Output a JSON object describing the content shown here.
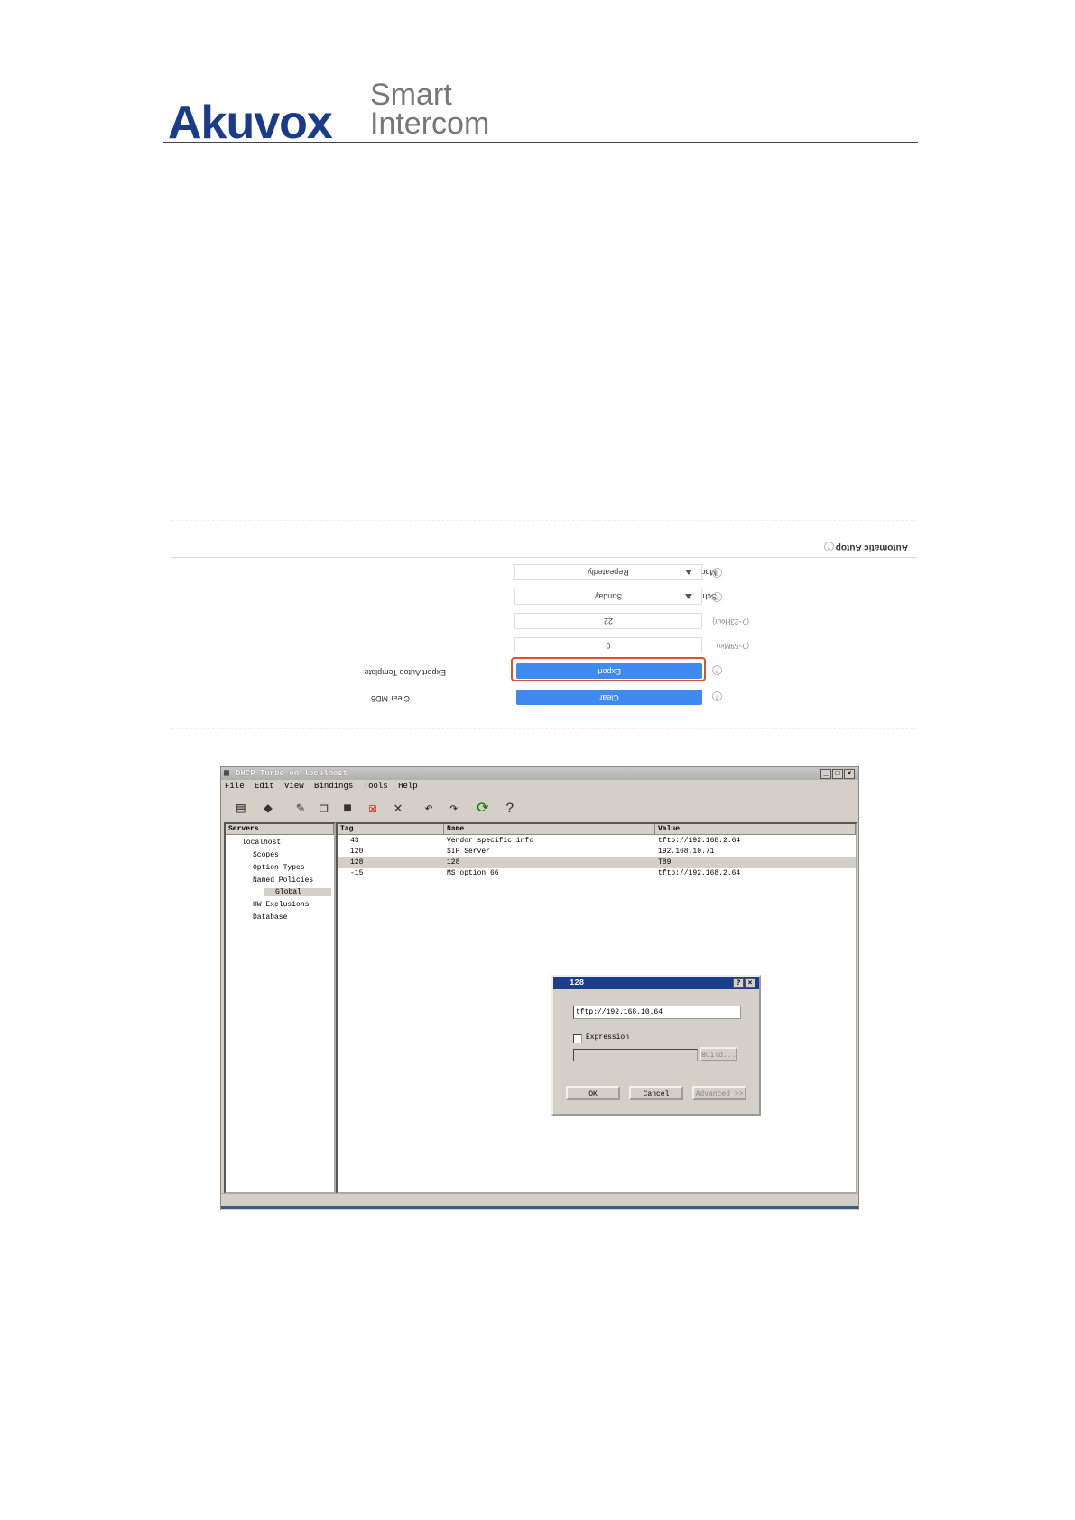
{
  "header": {
    "brand": "Akuvox",
    "tagline_line1": "Smart",
    "tagline_line2": "Intercom",
    "brand_color": "#1a3a8a"
  },
  "autop_panel": {
    "section_title": "Automatic Autop",
    "rows": [
      {
        "label": "Mode",
        "value": "Repeatedly",
        "control": "select"
      },
      {
        "label": "Schedule",
        "value": "Sunday",
        "control": "select"
      },
      {
        "label": "",
        "value": "22",
        "hint": "(0~23Hour)",
        "control": "input"
      },
      {
        "label": "",
        "value": "0",
        "hint": "(0~59Min)",
        "control": "input"
      },
      {
        "label": "Export Autop Template",
        "value": "Export",
        "control": "button"
      },
      {
        "label": "Clear MD5",
        "value": "Clear",
        "control": "button"
      }
    ],
    "highlight_color": "#d9542b",
    "button_color": "#3d8af0"
  },
  "dhcp_window": {
    "title": "DHCP Turbo on localhost",
    "menu": [
      "File",
      "Edit",
      "View",
      "Bindings",
      "Tools",
      "Help"
    ],
    "toolbar_icons": [
      "new-icon",
      "tag-icon",
      "pin-icon",
      "copy-icon",
      "paste-icon",
      "delete-icon",
      "tools-icon",
      "undo-icon",
      "redo-icon",
      "refresh-icon",
      "help-icon"
    ],
    "left_header": "Servers",
    "tree": [
      {
        "label": "localhost",
        "level": 0
      },
      {
        "label": "Scopes",
        "level": 1
      },
      {
        "label": "Option Types",
        "level": 1
      },
      {
        "label": "Named Policies",
        "level": 1
      },
      {
        "label": "Global",
        "level": 2,
        "selected": true
      },
      {
        "label": "HW Exclusions",
        "level": 1
      },
      {
        "label": "Database",
        "level": 1
      }
    ],
    "columns": [
      "Tag",
      "Name",
      "Value"
    ],
    "rows": [
      {
        "tag": "43",
        "name": "Vendor specific info",
        "value": "tftp://192.168.2.64"
      },
      {
        "tag": "120",
        "name": "SIP Server",
        "value": "192.168.10.71"
      },
      {
        "tag": "128",
        "name": "128",
        "value": "T89",
        "selected": true
      },
      {
        "tag": "-15",
        "name": "MS option 66",
        "value": "tftp://192.168.2.64"
      }
    ],
    "dialog": {
      "title": "128",
      "value": "tftp://192.168.10.64",
      "expression_label": "Expression",
      "build_label": "Build...",
      "ok_label": "OK",
      "cancel_label": "Cancel",
      "advanced_label": "Advanced >>"
    }
  }
}
